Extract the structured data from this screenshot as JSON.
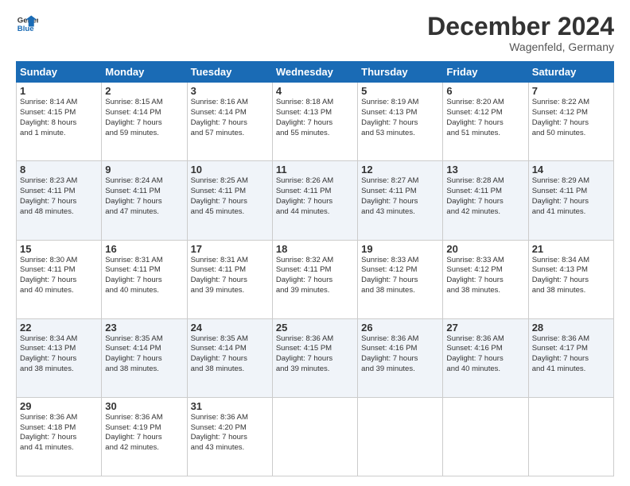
{
  "header": {
    "logo_line1": "General",
    "logo_line2": "Blue",
    "month": "December 2024",
    "location": "Wagenfeld, Germany"
  },
  "days_of_week": [
    "Sunday",
    "Monday",
    "Tuesday",
    "Wednesday",
    "Thursday",
    "Friday",
    "Saturday"
  ],
  "weeks": [
    [
      {
        "day": "1",
        "text": "Sunrise: 8:14 AM\nSunset: 4:15 PM\nDaylight: 8 hours\nand 1 minute."
      },
      {
        "day": "2",
        "text": "Sunrise: 8:15 AM\nSunset: 4:14 PM\nDaylight: 7 hours\nand 59 minutes."
      },
      {
        "day": "3",
        "text": "Sunrise: 8:16 AM\nSunset: 4:14 PM\nDaylight: 7 hours\nand 57 minutes."
      },
      {
        "day": "4",
        "text": "Sunrise: 8:18 AM\nSunset: 4:13 PM\nDaylight: 7 hours\nand 55 minutes."
      },
      {
        "day": "5",
        "text": "Sunrise: 8:19 AM\nSunset: 4:13 PM\nDaylight: 7 hours\nand 53 minutes."
      },
      {
        "day": "6",
        "text": "Sunrise: 8:20 AM\nSunset: 4:12 PM\nDaylight: 7 hours\nand 51 minutes."
      },
      {
        "day": "7",
        "text": "Sunrise: 8:22 AM\nSunset: 4:12 PM\nDaylight: 7 hours\nand 50 minutes."
      }
    ],
    [
      {
        "day": "8",
        "text": "Sunrise: 8:23 AM\nSunset: 4:11 PM\nDaylight: 7 hours\nand 48 minutes."
      },
      {
        "day": "9",
        "text": "Sunrise: 8:24 AM\nSunset: 4:11 PM\nDaylight: 7 hours\nand 47 minutes."
      },
      {
        "day": "10",
        "text": "Sunrise: 8:25 AM\nSunset: 4:11 PM\nDaylight: 7 hours\nand 45 minutes."
      },
      {
        "day": "11",
        "text": "Sunrise: 8:26 AM\nSunset: 4:11 PM\nDaylight: 7 hours\nand 44 minutes."
      },
      {
        "day": "12",
        "text": "Sunrise: 8:27 AM\nSunset: 4:11 PM\nDaylight: 7 hours\nand 43 minutes."
      },
      {
        "day": "13",
        "text": "Sunrise: 8:28 AM\nSunset: 4:11 PM\nDaylight: 7 hours\nand 42 minutes."
      },
      {
        "day": "14",
        "text": "Sunrise: 8:29 AM\nSunset: 4:11 PM\nDaylight: 7 hours\nand 41 minutes."
      }
    ],
    [
      {
        "day": "15",
        "text": "Sunrise: 8:30 AM\nSunset: 4:11 PM\nDaylight: 7 hours\nand 40 minutes."
      },
      {
        "day": "16",
        "text": "Sunrise: 8:31 AM\nSunset: 4:11 PM\nDaylight: 7 hours\nand 40 minutes."
      },
      {
        "day": "17",
        "text": "Sunrise: 8:31 AM\nSunset: 4:11 PM\nDaylight: 7 hours\nand 39 minutes."
      },
      {
        "day": "18",
        "text": "Sunrise: 8:32 AM\nSunset: 4:11 PM\nDaylight: 7 hours\nand 39 minutes."
      },
      {
        "day": "19",
        "text": "Sunrise: 8:33 AM\nSunset: 4:12 PM\nDaylight: 7 hours\nand 38 minutes."
      },
      {
        "day": "20",
        "text": "Sunrise: 8:33 AM\nSunset: 4:12 PM\nDaylight: 7 hours\nand 38 minutes."
      },
      {
        "day": "21",
        "text": "Sunrise: 8:34 AM\nSunset: 4:13 PM\nDaylight: 7 hours\nand 38 minutes."
      }
    ],
    [
      {
        "day": "22",
        "text": "Sunrise: 8:34 AM\nSunset: 4:13 PM\nDaylight: 7 hours\nand 38 minutes."
      },
      {
        "day": "23",
        "text": "Sunrise: 8:35 AM\nSunset: 4:14 PM\nDaylight: 7 hours\nand 38 minutes."
      },
      {
        "day": "24",
        "text": "Sunrise: 8:35 AM\nSunset: 4:14 PM\nDaylight: 7 hours\nand 38 minutes."
      },
      {
        "day": "25",
        "text": "Sunrise: 8:36 AM\nSunset: 4:15 PM\nDaylight: 7 hours\nand 39 minutes."
      },
      {
        "day": "26",
        "text": "Sunrise: 8:36 AM\nSunset: 4:16 PM\nDaylight: 7 hours\nand 39 minutes."
      },
      {
        "day": "27",
        "text": "Sunrise: 8:36 AM\nSunset: 4:16 PM\nDaylight: 7 hours\nand 40 minutes."
      },
      {
        "day": "28",
        "text": "Sunrise: 8:36 AM\nSunset: 4:17 PM\nDaylight: 7 hours\nand 41 minutes."
      }
    ],
    [
      {
        "day": "29",
        "text": "Sunrise: 8:36 AM\nSunset: 4:18 PM\nDaylight: 7 hours\nand 41 minutes."
      },
      {
        "day": "30",
        "text": "Sunrise: 8:36 AM\nSunset: 4:19 PM\nDaylight: 7 hours\nand 42 minutes."
      },
      {
        "day": "31",
        "text": "Sunrise: 8:36 AM\nSunset: 4:20 PM\nDaylight: 7 hours\nand 43 minutes."
      },
      null,
      null,
      null,
      null
    ]
  ]
}
